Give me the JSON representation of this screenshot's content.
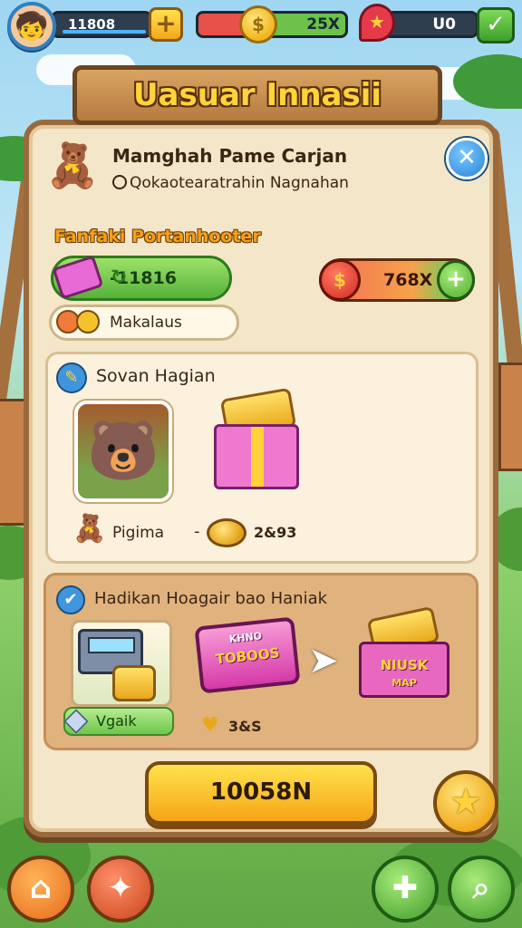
{
  "hud": {
    "xp_value": "11808",
    "coin_amount": "25X",
    "gem_amount": "U0"
  },
  "panel": {
    "title": "Uasuar Innasii",
    "header_title": "Mamghah Pame Carjan",
    "header_subtitle": "Qokaotearatrahin Nagnahan"
  },
  "rewards": {
    "section_title": "Fanfaki Portanhooter",
    "green_value": "-11816",
    "red_value": "768X",
    "cream_label": "Makalaus"
  },
  "card1": {
    "title": "Sovan Hagian",
    "label": "Pigima",
    "value": "2&93"
  },
  "card2": {
    "title": "Hadikan Hoagair bao Haniak",
    "ticket_label": "KHNO",
    "ticket_text": "TOBOOS",
    "gift_label": "NIUSK",
    "gift_sub": "MAP",
    "vouch_label": "Vgaik",
    "value": "3&S"
  },
  "main_button": {
    "label": "10058N"
  },
  "colors": {
    "panel_bg": "#f4e6c8",
    "panel_border": "#9b6a3c",
    "title_text": "#ffd33a",
    "primary_button": "#f6a516",
    "accent_blue": "#2a83d6",
    "accent_green": "#55b23a"
  },
  "icons": {
    "avatar": "player-avatar",
    "close": "close-icon",
    "star": "star-icon",
    "nav": [
      "home-icon",
      "magic-wand-icon",
      "tools-icon",
      "search-icon"
    ]
  }
}
